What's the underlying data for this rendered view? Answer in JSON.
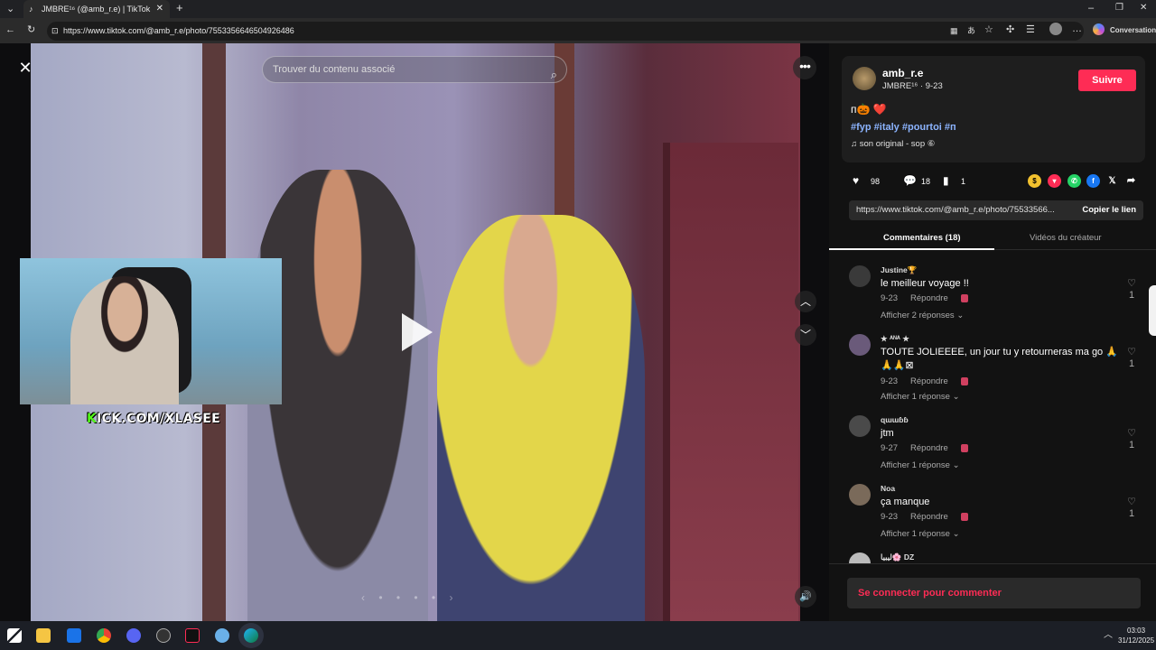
{
  "browser": {
    "tab_title": "JMBRE¹⁶ (@amb_r.e) | TikTok",
    "url": "https://www.tiktok.com/@amb_r.e/photo/7553356646504926486",
    "conversation_label": "Conversation"
  },
  "viewer": {
    "search_placeholder": "Trouver du contenu associé",
    "kick_text_k": "K",
    "kick_text": "ICK.COM/XLASEE"
  },
  "post": {
    "username": "amb_r.e",
    "display_line": "JMBRE¹⁶ · 9-23",
    "follow_label": "Suivre",
    "caption": "ᴨ🎃 ❤️",
    "hashtags": "#fyp #italy #pourtoi #ᴨ",
    "music": "son original - sop ⑥",
    "likes": "98",
    "comments": "18",
    "saves": "1",
    "link_text": "https://www.tiktok.com/@amb_r.e/photo/75533566...",
    "copy_link_label": "Copier le lien"
  },
  "tabs": {
    "comments": "Commentaires (18)",
    "creator_videos": "Vidéos du créateur"
  },
  "comments": [
    {
      "name": "Justine🏆",
      "text": "le meilleur voyage !!",
      "date": "9-23",
      "reply": "Répondre",
      "replies": "Afficher 2 réponses ⌄",
      "likes": "1"
    },
    {
      "name": "★ ᴬᴺᴬ ★",
      "text": "TOUTE JOLIEEEE, un jour tu y retourneras ma go 🙏🙏🙏⊠",
      "date": "9-23",
      "reply": "Répondre",
      "replies": "Afficher 1 réponse ⌄",
      "likes": "1"
    },
    {
      "name": "ɋɯɯɓɓ",
      "text": "jtm",
      "date": "9-27",
      "reply": "Répondre",
      "replies": "Afficher 1 réponse ⌄",
      "likes": "1"
    },
    {
      "name": "Noa",
      "text": "ça manque",
      "date": "9-23",
      "reply": "Répondre",
      "replies": "Afficher 1 réponse ⌄",
      "likes": "1"
    },
    {
      "name": "ليبيا🌸 DZ"
    }
  ],
  "login_label": "Se connecter pour commenter",
  "clock": {
    "time": "03:03",
    "date": "31/12/2025"
  },
  "colors": {
    "accent": "#fe2c55",
    "hashtag": "#8cb4ff",
    "kick_green": "#53fc18"
  }
}
